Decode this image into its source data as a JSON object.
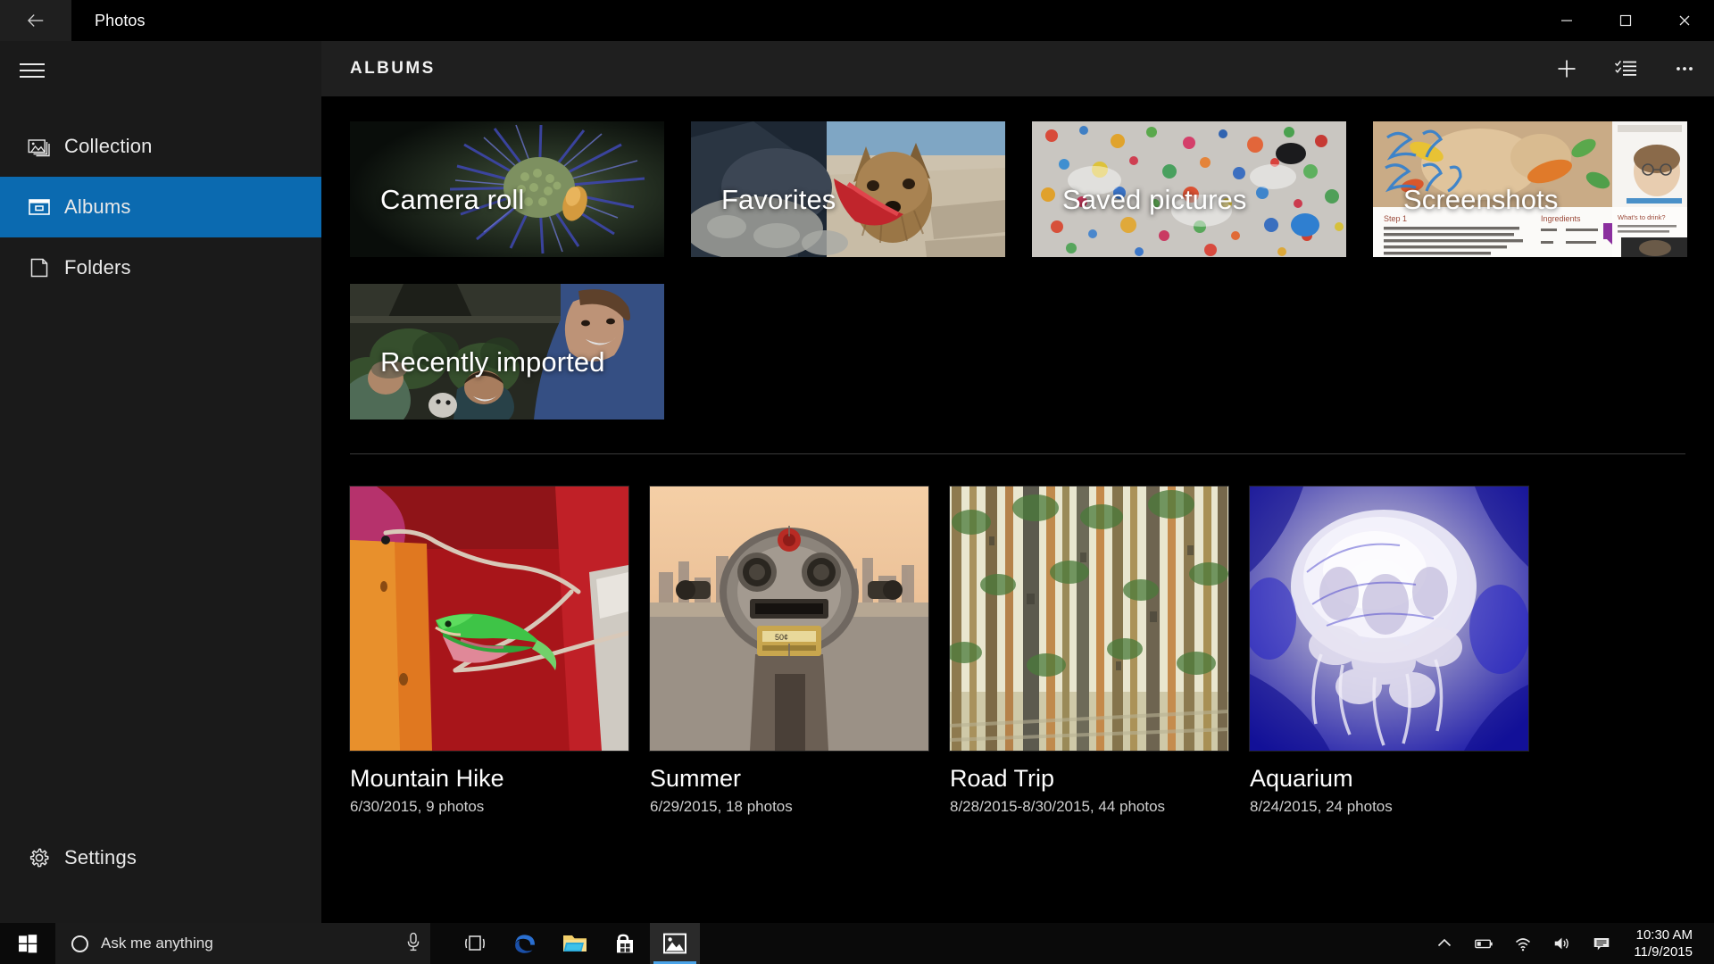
{
  "titlebar": {
    "back_icon": "back-arrow-icon",
    "title": "Photos",
    "minimize_icon": "minimize-icon",
    "maximize_icon": "maximize-icon",
    "close_icon": "close-icon"
  },
  "sidebar": {
    "hamburger_icon": "hamburger-menu-icon",
    "items": [
      {
        "label": "Collection",
        "icon": "collection-icon",
        "active": false
      },
      {
        "label": "Albums",
        "icon": "albums-icon",
        "active": true
      },
      {
        "label": "Folders",
        "icon": "folders-icon",
        "active": false
      }
    ],
    "settings": {
      "label": "Settings",
      "icon": "gear-icon"
    },
    "accent_color": "#0b6ab0"
  },
  "main": {
    "header": {
      "title": "ALBUMS",
      "add_icon": "plus-icon",
      "select_icon": "select-checklist-icon",
      "more_icon": "more-options-icon"
    },
    "banners": [
      {
        "name": "Camera roll",
        "image": "blue-thistle-flower-photo"
      },
      {
        "name": "Favorites",
        "image": "yorkshire-terrier-dog-photo"
      },
      {
        "name": "Saved pictures",
        "image": "colorful-paint-splatter-photo"
      },
      {
        "name": "Screenshots",
        "image": "recipe-webpage-screenshot"
      },
      {
        "name": "Recently imported",
        "image": "smiling-people-outdoors-photo"
      }
    ],
    "albums": [
      {
        "title": "Mountain Hike",
        "meta": "6/30/2015, 9 photos",
        "image": "green-anole-lizard-photo"
      },
      {
        "title": "Summer",
        "meta": "6/29/2015, 18 photos",
        "image": "coin-operated-binoculars-photo"
      },
      {
        "title": "Road Trip",
        "meta": "8/28/2015-8/30/2015, 44 photos",
        "image": "pine-forest-trees-photo"
      },
      {
        "title": "Aquarium",
        "meta": "8/24/2015, 24 photos",
        "image": "blue-jellyfish-photo"
      }
    ]
  },
  "taskbar": {
    "start_icon": "windows-start-icon",
    "search": {
      "placeholder": "Ask me anything",
      "cortana_icon": "cortana-circle-icon",
      "mic_icon": "microphone-icon"
    },
    "apps": [
      {
        "name": "task-view",
        "icon": "task-view-icon",
        "active": false
      },
      {
        "name": "edge",
        "icon": "edge-browser-icon",
        "active": false
      },
      {
        "name": "file-explorer",
        "icon": "file-explorer-icon",
        "active": false
      },
      {
        "name": "microsoft-store",
        "icon": "microsoft-store-icon",
        "active": false
      },
      {
        "name": "photos",
        "icon": "photos-app-icon",
        "active": true
      }
    ],
    "tray": [
      {
        "name": "show-hidden-icons",
        "icon": "chevron-up-icon"
      },
      {
        "name": "battery",
        "icon": "battery-icon"
      },
      {
        "name": "network",
        "icon": "wifi-icon"
      },
      {
        "name": "volume",
        "icon": "speaker-icon"
      },
      {
        "name": "action-center",
        "icon": "notification-icon"
      }
    ],
    "clock": {
      "time": "10:30 AM",
      "date": "11/9/2015"
    }
  }
}
